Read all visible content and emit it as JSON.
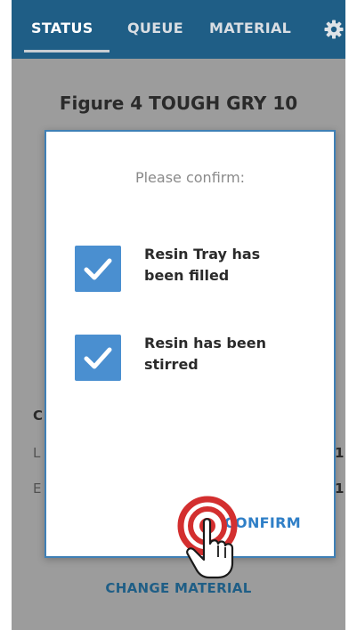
{
  "nav": {
    "tabs": [
      {
        "label": "STATUS",
        "active": true
      },
      {
        "label": "QUEUE",
        "active": false
      },
      {
        "label": "MATERIAL",
        "active": false
      }
    ],
    "settings_icon": "gear-icon"
  },
  "page": {
    "title": "Figure 4 TOUGH GRY 10",
    "obscured_fragments": [
      "C",
      "L",
      "E",
      "1",
      "1"
    ]
  },
  "modal": {
    "title": "Please confirm:",
    "items": [
      {
        "label": "Resin Tray has been filled",
        "checked": true
      },
      {
        "label": "Resin has been stirred",
        "checked": true
      }
    ],
    "confirm_label": "CONFIRM"
  },
  "footer": {
    "change_material_label": "CHANGE MATERIAL"
  },
  "overlay": {
    "icon": "tap-hand-icon"
  },
  "colors": {
    "navbar": "#1f5e86",
    "accent": "#2f7fc7",
    "checkbox": "#4a8fd0",
    "backdrop": "#9c9c9c",
    "tap_ring": "#d32f2f"
  }
}
